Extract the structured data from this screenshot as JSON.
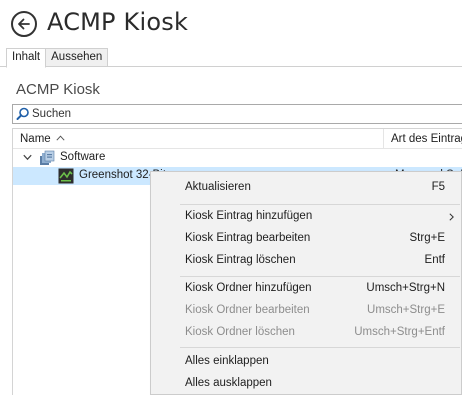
{
  "window": {
    "title": "ACMP Kiosk"
  },
  "tabs": [
    {
      "label": "Inhalt",
      "active": true
    },
    {
      "label": "Aussehen",
      "active": false
    }
  ],
  "section": {
    "title": "ACMP Kiosk"
  },
  "search": {
    "placeholder": "Suchen",
    "value": ""
  },
  "grid": {
    "columns": [
      {
        "label": "Name",
        "sort": "ascending"
      },
      {
        "label": "Art des Eintrag"
      }
    ],
    "rows": [
      {
        "label": "Software",
        "type": "",
        "expanded": true,
        "icon": "software-folder-icon"
      },
      {
        "label": "Greenshot 32-Bit",
        "type": "Managed Soft",
        "selected": true,
        "icon": "greenshot-icon"
      }
    ]
  },
  "context_menu": {
    "items": [
      {
        "label": "Aktualisieren",
        "shortcut": "F5",
        "enabled": true
      },
      {
        "label": "Kiosk Eintrag hinzufügen",
        "shortcut": "",
        "enabled": true,
        "submenu": true
      },
      {
        "label": "Kiosk Eintrag bearbeiten",
        "shortcut": "Strg+E",
        "enabled": true
      },
      {
        "label": "Kiosk Eintrag löschen",
        "shortcut": "Entf",
        "enabled": true
      },
      {
        "label": "Kiosk Ordner hinzufügen",
        "shortcut": "Umsch+Strg+N",
        "enabled": true
      },
      {
        "label": "Kiosk Ordner bearbeiten",
        "shortcut": "Umsch+Strg+E",
        "enabled": false
      },
      {
        "label": "Kiosk Ordner löschen",
        "shortcut": "Umsch+Strg+Entf",
        "enabled": false
      },
      {
        "label": "Alles einklappen",
        "shortcut": "",
        "enabled": true
      },
      {
        "label": "Alles ausklappen",
        "shortcut": "",
        "enabled": true
      }
    ]
  },
  "colors": {
    "selection": "#cce8ff",
    "menu_background": "#f2f2f2",
    "disabled_text": "#8d8d8d"
  }
}
